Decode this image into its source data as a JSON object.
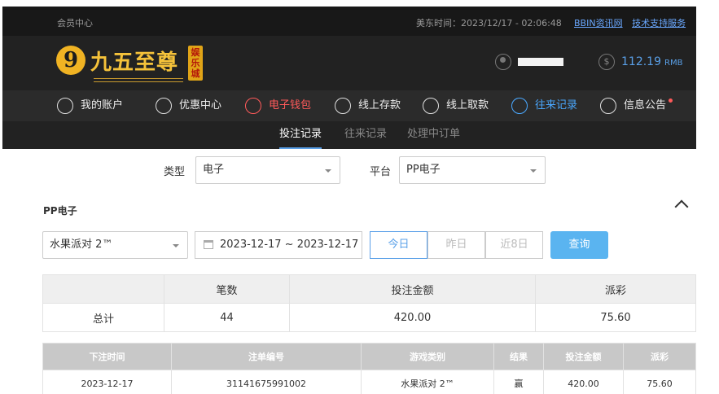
{
  "topbar": {
    "member_center": "会员中心",
    "time": "美东时间：2023/12/17 - 02:06:48",
    "link_info": "BBIN资讯网",
    "link_support": "技术支持服务"
  },
  "logo": {
    "digit": "9",
    "text": "九五至尊",
    "tag": "娱乐城"
  },
  "account": {
    "balance": "112.19",
    "unit": "RMB"
  },
  "nav": {
    "items": [
      {
        "label": "我的账户",
        "icon": "user-circle-icon"
      },
      {
        "label": "优惠中心",
        "icon": "gift-icon"
      },
      {
        "label": "电子钱包",
        "icon": "wallet-icon"
      },
      {
        "label": "线上存款",
        "icon": "deposit-icon"
      },
      {
        "label": "线上取款",
        "icon": "withdraw-icon"
      },
      {
        "label": "往来记录",
        "icon": "records-icon"
      },
      {
        "label": "信息公告",
        "icon": "bell-icon"
      }
    ]
  },
  "subnav": {
    "tabs": [
      "投注记录",
      "往来记录",
      "处理中订单"
    ]
  },
  "filters": {
    "type_label": "类型",
    "type_value": "电子",
    "platform_label": "平台",
    "platform_value": "PP电子"
  },
  "section": {
    "title": "PP电子"
  },
  "controls": {
    "game_value": "水果派对 2™",
    "date_range": "2023-12-17 ~ 2023-12-17",
    "today": "今日",
    "yesterday": "昨日",
    "last8": "近8日",
    "query": "查询"
  },
  "summary": {
    "headers": [
      "",
      "笔数",
      "投注金额",
      "派彩"
    ],
    "row": [
      "总计",
      "44",
      "420.00",
      "75.60"
    ]
  },
  "details": {
    "headers": [
      "下注时间",
      "注单编号",
      "游戏类别",
      "结果",
      "投注金额",
      "派彩"
    ],
    "rows": [
      [
        "2023-12-17",
        "31141675991002",
        "水果派对 2™",
        "赢",
        "420.00",
        "75.60"
      ]
    ]
  },
  "colors": {
    "accent": "#5aa0e8",
    "active_red": "#ff5a5a",
    "gold": "#f5c23a"
  }
}
